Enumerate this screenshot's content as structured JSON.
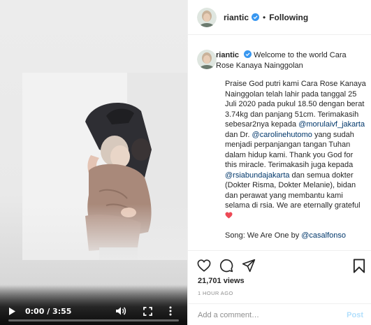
{
  "video": {
    "time_display": "0:00 / 3:55",
    "progress": 0,
    "watermark": "",
    "icons": {
      "play": "play-icon",
      "volume": "volume-icon",
      "fullscreen": "fullscreen-icon",
      "more": "more-vertical-icon"
    }
  },
  "header": {
    "username": "riantic",
    "separator": "•",
    "follow_status": "Following",
    "verified_icon": "verified-badge-icon"
  },
  "caption": {
    "username": "riantic",
    "headline": "Welcome to the world Cara Rose Kanaya Nainggolan",
    "body": [
      {
        "t": "text",
        "v": "Praise God putri kami Cara Rose Kanaya Nainggolan telah lahir pada tanggal 25 Juli 2020 pada pukul 18.50 dengan berat 3.74kg dan panjang 51cm. Terimakasih sebesar2nya kepada "
      },
      {
        "t": "mention",
        "v": "@morulaivf_jakarta"
      },
      {
        "t": "text",
        "v": " dan Dr. "
      },
      {
        "t": "mention",
        "v": "@carolinehutomo"
      },
      {
        "t": "text",
        "v": " yang sudah menjadi perpanjangan tangan Tuhan dalam hidup kami. Thank you God for this miracle. Terimakasih juga kepada "
      },
      {
        "t": "mention",
        "v": "@rsiabundajakarta"
      },
      {
        "t": "text",
        "v": " dan semua dokter (Dokter Risma, Dokter Melanie), bidan dan perawat yang membantu kami selama di rsia. We are eternally grateful "
      }
    ],
    "song_prefix": "Song: We Are One by ",
    "song_mention": "@casalfonso"
  },
  "actions": {
    "views": "21,701 views",
    "timestamp": "1 HOUR AGO",
    "comment_placeholder": "Add a comment…",
    "post_label": "Post",
    "icons": {
      "like": "heart-icon",
      "comment": "comment-icon",
      "share": "share-icon",
      "save": "bookmark-icon"
    }
  },
  "colors": {
    "mention": "#00376b",
    "verified": "#3897f0",
    "heart": "#ed4956",
    "post_disabled": "#b2dffc",
    "muted": "#8e8e8e"
  }
}
